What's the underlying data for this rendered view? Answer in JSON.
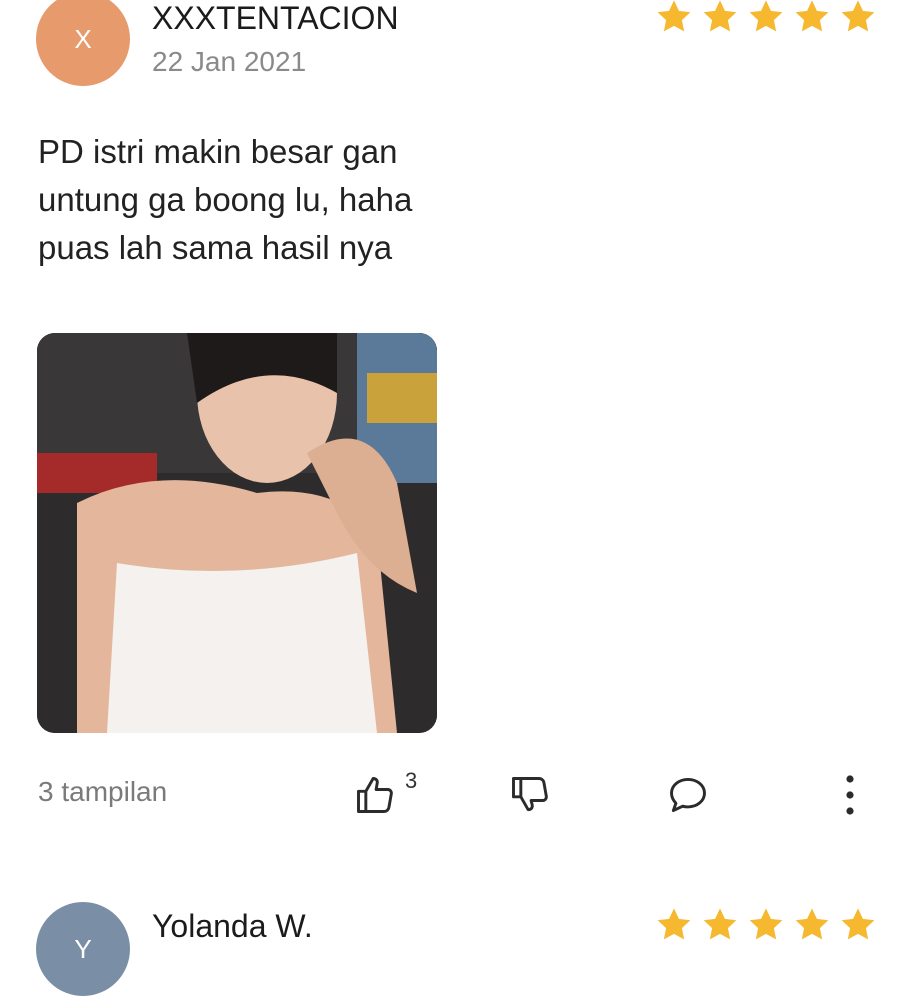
{
  "reviews": [
    {
      "avatar_letter": "X",
      "avatar_color": "#E79A6B",
      "username": "XXXTENTACION",
      "date": "22 Jan 2021",
      "rating": 5,
      "text_lines": [
        "PD istri makin besar gan",
        "untung ga boong lu, haha",
        "puas lah sama hasil nya"
      ],
      "views": "3 tampilan",
      "likes": "3"
    },
    {
      "avatar_letter": "Y",
      "avatar_color": "#7A8FA6",
      "username": "Yolanda W.",
      "rating": 5
    }
  ],
  "colors": {
    "star": "#F5B82E",
    "icon": "#2b2b2b"
  },
  "icons": {
    "like": "thumbs-up-icon",
    "dislike": "thumbs-down-icon",
    "comment": "comment-icon",
    "more": "more-vertical-icon"
  }
}
